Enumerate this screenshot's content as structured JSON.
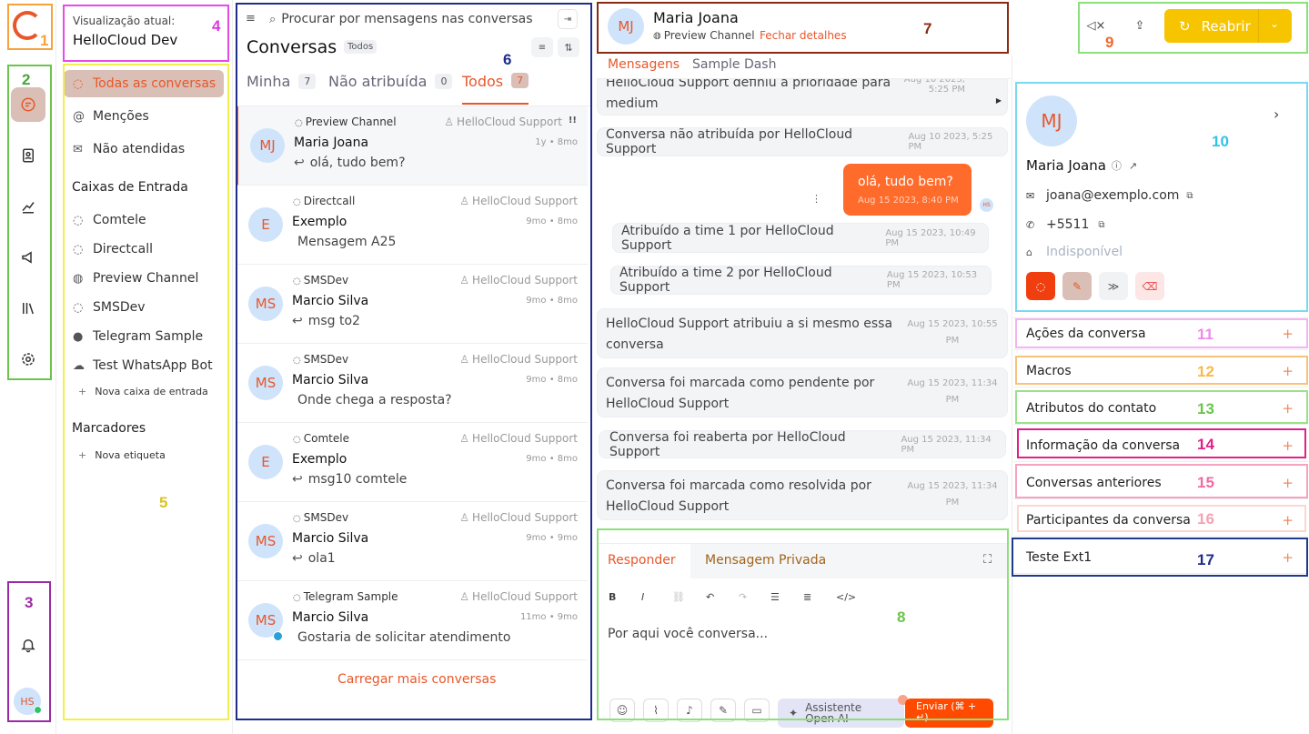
{
  "logo": {
    "label": "1"
  },
  "annotations": [
    "1",
    "2",
    "3",
    "4",
    "5",
    "6",
    "7",
    "8",
    "9",
    "10",
    "11",
    "12",
    "13",
    "14",
    "15",
    "16",
    "17"
  ],
  "nav": {
    "user_initials": "HS"
  },
  "sidebar": {
    "view_label": "Visualização atual:",
    "view_value": "HelloCloud Dev",
    "items": [
      {
        "label": "Todas as conversas"
      },
      {
        "label": "Menções"
      },
      {
        "label": "Não atendidas"
      }
    ],
    "inboxes_title": "Caixas de Entrada",
    "inboxes": [
      {
        "label": "Comtele"
      },
      {
        "label": "Directcall"
      },
      {
        "label": "Preview Channel"
      },
      {
        "label": "SMSDev"
      },
      {
        "label": "Telegram Sample"
      },
      {
        "label": "Test WhatsApp Bot"
      }
    ],
    "new_inbox": "Nova caixa de entrada",
    "labels_title": "Marcadores",
    "new_label": "Nova etiqueta"
  },
  "conversations": {
    "search_placeholder": "Procurar por mensagens nas conversas",
    "title": "Conversas",
    "filter_badge": "Todos",
    "tabs": [
      {
        "label": "Minha",
        "count": "7"
      },
      {
        "label": "Não atribuída",
        "count": "0"
      },
      {
        "label": "Todos",
        "count": "7"
      }
    ],
    "items": [
      {
        "initials": "MJ",
        "channel": "Preview Channel",
        "agent": "HelloCloud Support",
        "name": "Maria Joana",
        "time": "1y • 8mo",
        "message": "olá, tudo bem?",
        "reply": "↩",
        "priority": "!!"
      },
      {
        "initials": "E",
        "channel": "Directcall",
        "agent": "HelloCloud Support",
        "name": "Exemplo",
        "time": "9mo • 8mo",
        "message": "Mensagem A25",
        "reply": ""
      },
      {
        "initials": "MS",
        "channel": "SMSDev",
        "agent": "HelloCloud Support",
        "name": "Marcio Silva",
        "time": "9mo • 8mo",
        "message": "msg to2",
        "reply": "↩"
      },
      {
        "initials": "MS",
        "channel": "SMSDev",
        "agent": "HelloCloud Support",
        "name": "Marcio Silva",
        "time": "9mo • 8mo",
        "message": "Onde chega a resposta?",
        "reply": ""
      },
      {
        "initials": "E",
        "channel": "Comtele",
        "agent": "HelloCloud Support",
        "name": "Exemplo",
        "time": "9mo • 8mo",
        "message": "msg10 comtele",
        "reply": "↩"
      },
      {
        "initials": "MS",
        "channel": "SMSDev",
        "agent": "HelloCloud Support",
        "name": "Marcio Silva",
        "time": "9mo • 9mo",
        "message": "ola1",
        "reply": "↩"
      },
      {
        "initials": "MS",
        "channel": "Telegram Sample",
        "agent": "HelloCloud Support",
        "name": "Marcio Silva",
        "time": "11mo • 9mo",
        "message": "Gostaria de solicitar atendimento",
        "reply": ""
      }
    ],
    "load_more": "Carregar mais conversas"
  },
  "chat": {
    "contact_initials": "MJ",
    "contact_name": "Maria Joana",
    "channel": "Preview Channel",
    "close_details": "Fechar detalhes",
    "tabs": [
      {
        "label": "Mensagens"
      },
      {
        "label": "Sample Dash"
      }
    ],
    "activities": [
      {
        "text": "HelloCloud Support definiu a prioridade para medium",
        "time": "Aug 10 2023, 5:25 PM"
      },
      {
        "text": "Conversa não atribuída por HelloCloud Support",
        "time": "Aug 10 2023, 5:25 PM"
      },
      {
        "text": "Atribuído a time 1 por HelloCloud Support",
        "time": "Aug 15 2023, 10:49 PM"
      },
      {
        "text": "Atribuído a time 2 por HelloCloud Support",
        "time": "Aug 15 2023, 10:53 PM"
      },
      {
        "text": "HelloCloud Support atribuiu a si mesmo essa conversa",
        "time": "Aug 15 2023, 10:55 PM"
      },
      {
        "text": "Conversa foi marcada como pendente por HelloCloud Support",
        "time": "Aug 15 2023, 11:34 PM"
      },
      {
        "text": "Conversa foi reaberta por HelloCloud Support",
        "time": "Aug 15 2023, 11:34 PM"
      },
      {
        "text": "Conversa foi marcada como resolvida por HelloCloud Support",
        "time": "Aug 15 2023, 11:34 PM"
      }
    ],
    "outgoing": {
      "text": "olá, tudo bem?",
      "time": "Aug 15 2023, 8:40 PM",
      "avatar": "HS"
    }
  },
  "composer": {
    "tab_reply": "Responder",
    "tab_private": "Mensagem Privada",
    "placeholder": "Por aqui você conversa...",
    "assistant": "Assistente Open AI",
    "send": "Enviar (⌘ + ↵)",
    "toolbar": [
      "B",
      "I"
    ]
  },
  "header_actions": {
    "reopen": "Reabrir"
  },
  "contact": {
    "initials": "MJ",
    "name": "Maria Joana",
    "email": "joana@exemplo.com",
    "phone": "+5511",
    "company": "Indisponível"
  },
  "accordions": [
    {
      "label": "Ações da conversa"
    },
    {
      "label": "Macros"
    },
    {
      "label": "Atributos do contato"
    },
    {
      "label": "Informação da conversa"
    },
    {
      "label": "Conversas anteriores"
    },
    {
      "label": "Participantes da conversa"
    },
    {
      "label": "Teste Ext1"
    }
  ],
  "colors": {
    "accent": "#e8572a",
    "reopen": "#f7c400",
    "active_nav": "#d9bfb6"
  }
}
